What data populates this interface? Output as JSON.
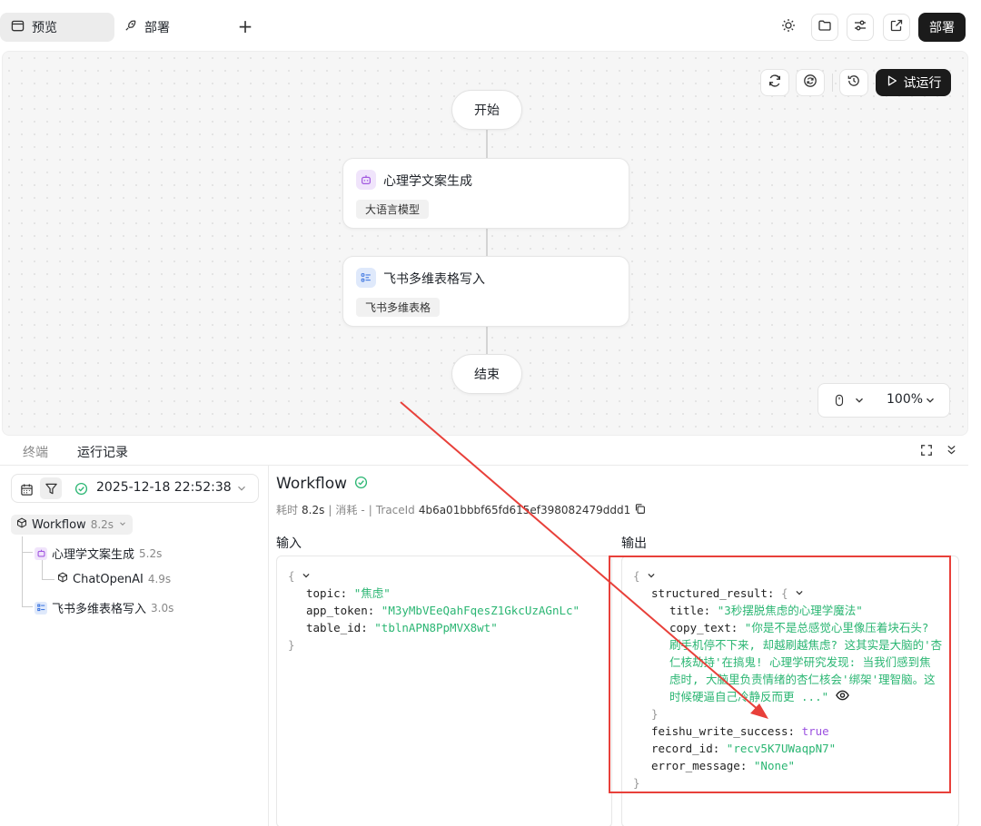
{
  "topbar": {
    "tabs": [
      {
        "label": "预览",
        "icon": "browser-window-icon"
      },
      {
        "label": "部署",
        "icon": "rocket-icon"
      }
    ],
    "add_tab": "+",
    "deploy_label": "部署"
  },
  "canvas": {
    "run_label": "试运行",
    "nodes": {
      "start": "开始",
      "llm": {
        "title": "心理学文案生成",
        "tag": "大语言模型",
        "icon": "robot-icon"
      },
      "feishu": {
        "title": "飞书多维表格写入",
        "tag": "飞书多维表格",
        "icon": "table-icon"
      },
      "end": "结束"
    },
    "zoom": "100%"
  },
  "bottom": {
    "tabs": [
      "终端",
      "运行记录"
    ],
    "active_tab": "运行记录",
    "run_time": "2025-12-18 22:52:38",
    "tree": [
      {
        "label": "Workflow",
        "duration": "8.2s"
      },
      {
        "label": "心理学文案生成",
        "duration": "5.2s"
      },
      {
        "label": "ChatOpenAI",
        "duration": "4.9s"
      },
      {
        "label": "飞书多维表格写入",
        "duration": "3.0s"
      }
    ],
    "detail": {
      "title": "Workflow",
      "meta": {
        "time_label": "耗时",
        "time_value": "8.2s",
        "sep": "|",
        "cost_label": "消耗",
        "cost_value": "-",
        "trace_label": "TraceId",
        "trace_value": "4b6a01bbbf65fd615ef398082479ddd1"
      },
      "input_label": "输入",
      "output_label": "输出",
      "input": {
        "topic_key": "topic:",
        "topic": "\"焦虑\"",
        "app_token_key": "app_token:",
        "app_token": "\"M3yMbVEeQahFqesZ1GkcUzAGnLc\"",
        "table_id_key": "table_id:",
        "table_id": "\"tblnAPN8PpMVX8wt\""
      },
      "output": {
        "structured_result_key": "structured_result:",
        "title_key": "title:",
        "title": "\"3秒摆脱焦虑的心理学魔法\"",
        "copy_text_key": "copy_text:",
        "copy_text_lines": [
          "\"你是不是总感觉心里像压着块石头?",
          "刷手机停不下来, 却越刷越焦虑? 这其实是大脑的'杏",
          "仁核劫持'在搞鬼! 心理学研究发现: 当我们感到焦",
          "虑时, 大脑里负责情绪的杏仁核会'绑架'理智脑。这",
          "时候硬逼自己冷静反而更 ...\""
        ],
        "feishu_key": "feishu_write_success:",
        "feishu": "true",
        "record_id_key": "record_id:",
        "record_id": "\"recv5K7UWaqpN7\"",
        "error_key": "error_message:",
        "error": "\"None\""
      }
    }
  },
  "annotation": {
    "color": "#e8403a"
  }
}
